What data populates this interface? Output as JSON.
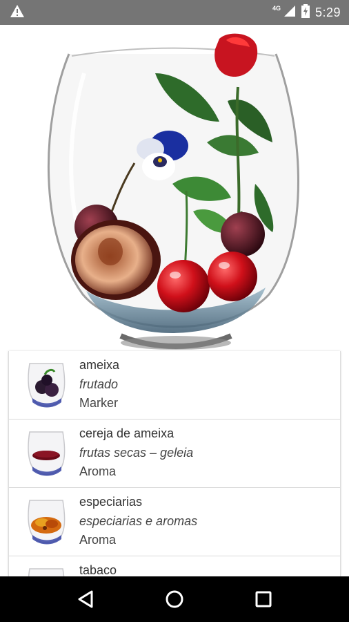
{
  "status_bar": {
    "time": "5:29",
    "network": "4G",
    "icons": [
      "warning-icon",
      "signal-icon",
      "battery-charging-icon"
    ]
  },
  "hero": {
    "image": "wine-glass-with-plum-cherries-rose-pansy"
  },
  "list": {
    "items": [
      {
        "name": "ameixa",
        "category": "frutado",
        "type": "Marker",
        "thumb": "plum-glass-thumb"
      },
      {
        "name": "cereja de ameixa",
        "category": "frutas secas – geleia",
        "type": "Aroma",
        "thumb": "jam-glass-thumb"
      },
      {
        "name": "especiarias",
        "category": "especiarias e aromas",
        "type": "Aroma",
        "thumb": "spice-glass-thumb"
      },
      {
        "name": "tabaco",
        "category": "",
        "type": "",
        "thumb": "tobacco-glass-thumb"
      }
    ]
  },
  "nav_bar": {
    "buttons": [
      "back-icon",
      "home-icon",
      "recents-icon"
    ]
  }
}
